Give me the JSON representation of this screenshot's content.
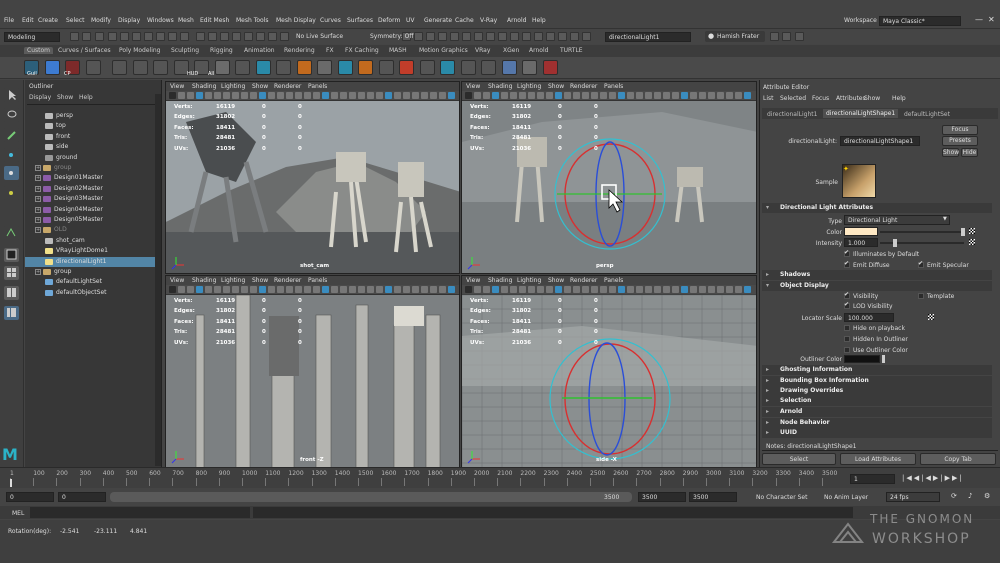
{
  "menubar": {
    "items": [
      "File",
      "Edit",
      "Create",
      "Select",
      "Modify",
      "Display",
      "Windows",
      "Mesh",
      "Edit Mesh",
      "Mesh Tools",
      "Mesh Display",
      "Curves",
      "Surfaces",
      "Deform",
      "UV",
      "Generate",
      "Cache",
      "V-Ray",
      "Arnold",
      "Help"
    ],
    "workspace_label": "Workspace :",
    "workspace_value": "Maya Classic*"
  },
  "statusline": {
    "mode": "Modeling",
    "live_surface": "No Live Surface",
    "symmetry": "Symmetry: Off",
    "search_value": "directionalLight1",
    "user": "Hamish Frater"
  },
  "shelf": {
    "tabs": [
      "Custom",
      "Curves / Surfaces",
      "Poly Modeling",
      "Sculpting",
      "Rigging",
      "Animation",
      "Rendering",
      "FX",
      "FX Caching",
      "MASH",
      "Motion Graphics",
      "VRay",
      "XGen",
      "Arnold",
      "TURTLE"
    ],
    "icon_labels": [
      "Guil",
      "CP",
      "HUD",
      "All"
    ]
  },
  "outliner": {
    "title": "Outliner",
    "menu": [
      "Display",
      "Show",
      "Help"
    ],
    "items": [
      {
        "label": "persp",
        "kind": "camera"
      },
      {
        "label": "top",
        "kind": "camera"
      },
      {
        "label": "front",
        "kind": "camera"
      },
      {
        "label": "side",
        "kind": "camera"
      },
      {
        "label": "ground",
        "kind": "mesh"
      },
      {
        "label": "group",
        "kind": "group"
      },
      {
        "label": "Design01Master",
        "kind": "master"
      },
      {
        "label": "Design02Master",
        "kind": "master"
      },
      {
        "label": "Design03Master",
        "kind": "master"
      },
      {
        "label": "Design04Master",
        "kind": "master"
      },
      {
        "label": "Design05Master",
        "kind": "master"
      },
      {
        "label": "OLD",
        "kind": "group"
      },
      {
        "label": "shot_cam",
        "kind": "camera"
      },
      {
        "label": "VRayLightDome1",
        "kind": "light"
      },
      {
        "label": "directionalLight1",
        "kind": "light"
      },
      {
        "label": "group",
        "kind": "group"
      },
      {
        "label": "defaultLightSet",
        "kind": "set"
      },
      {
        "label": "defaultObjectSet",
        "kind": "set"
      }
    ]
  },
  "viewport": {
    "menu": [
      "View",
      "Shading",
      "Lighting",
      "Show",
      "Renderer",
      "Panels"
    ],
    "hud_labels": [
      "Verts:",
      "Edges:",
      "Faces:",
      "Tris:",
      "UVs:"
    ],
    "hud_values": [
      "16119",
      "31802",
      "18411",
      "28481",
      "21036"
    ],
    "hud_zeros": [
      "0",
      "0",
      "0",
      "0",
      "0"
    ],
    "panels": [
      {
        "camera": "shot_cam"
      },
      {
        "camera": "persp"
      },
      {
        "camera": "front -Z"
      },
      {
        "camera": "side -X"
      }
    ]
  },
  "attribute_editor": {
    "title": "Attribute Editor",
    "menu": [
      "List",
      "Selected",
      "Focus",
      "Attributes",
      "Show",
      "Help"
    ],
    "tabs": [
      "directionalLight1",
      "directionalLightShape1",
      "defaultLightSet"
    ],
    "node_label": "directionalLight:",
    "node_value": "directionalLightShape1",
    "focus": "Focus",
    "presets": "Presets",
    "show": "Show",
    "hide": "Hide",
    "sample": "Sample",
    "sections": {
      "dla": "Directional Light Attributes",
      "shadows": "Shadows",
      "object_display": "Object Display",
      "ghosting": "Ghosting Information",
      "bbox": "Bounding Box Information",
      "overrides": "Drawing Overrides",
      "selection": "Selection",
      "arnold": "Arnold",
      "node_behavior": "Node Behavior",
      "uuid": "UUID"
    },
    "type_label": "Type",
    "type_value": "Directional Light",
    "color_label": "Color",
    "intensity_label": "Intensity",
    "intensity_value": "1.000",
    "illuminates": "Illuminates by Default",
    "emit_diffuse": "Emit Diffuse",
    "emit_specular": "Emit Specular",
    "visibility": "Visibility",
    "template": "Template",
    "lod": "LOD Visibility",
    "locator_scale_label": "Locator Scale",
    "locator_scale_value": "100.000",
    "hide_playback": "Hide on playback",
    "hidden_outliner": "Hidden In Outliner",
    "use_outliner_color": "Use Outliner Color",
    "outliner_color": "Outliner Color",
    "notes": "Notes: directionalLightShape1",
    "select_btn": "Select",
    "load_btn": "Load Attributes",
    "copy_btn": "Copy Tab"
  },
  "timeline": {
    "ticks": [
      "1",
      "100",
      "200",
      "300",
      "400",
      "500",
      "600",
      "700",
      "800",
      "900",
      "1000",
      "1100",
      "1200",
      "1300",
      "1400",
      "1500",
      "1600",
      "1700",
      "1800",
      "1900",
      "2000",
      "2100",
      "2200",
      "2300",
      "2400",
      "2500",
      "2600",
      "2700",
      "2800",
      "2900",
      "3000",
      "3100",
      "3200",
      "3300",
      "3400",
      "3500"
    ],
    "current_frame": "1",
    "range_start": "0",
    "range_start2": "0",
    "range_inner_end": "3500",
    "range_end": "3500",
    "range_end2": "3500",
    "character_set": "No Character Set",
    "anim_layer": "No Anim Layer",
    "fps": "24 fps",
    "mel": "MEL",
    "rotation_label": "Rotation(deg):",
    "rotation_values": [
      "-2.541",
      "-23.111",
      "4.841"
    ]
  },
  "watermark": {
    "line1": "THE GNOMON",
    "line2": "WORKSHOP"
  },
  "colors": {
    "accent_selected": "#5285a6",
    "light_color": "#ffe9c4",
    "viewport_bg": "#7d8284"
  }
}
